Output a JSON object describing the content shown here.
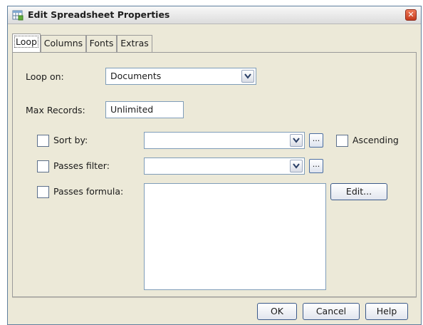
{
  "window": {
    "title": "Edit Spreadsheet Properties",
    "close_symbol": "✕"
  },
  "tabs": [
    {
      "label": "Loop",
      "active": true
    },
    {
      "label": "Columns",
      "active": false
    },
    {
      "label": "Fonts",
      "active": false
    },
    {
      "label": "Extras",
      "active": false
    }
  ],
  "loop": {
    "loop_on_label": "Loop on:",
    "loop_on_value": "Documents",
    "max_records_label": "Max Records:",
    "max_records_value": "Unlimited",
    "sort_by_label": "Sort by:",
    "sort_by_value": "",
    "sort_by_checked": false,
    "ascending_label": "Ascending",
    "ascending_checked": false,
    "passes_filter_label": "Passes filter:",
    "passes_filter_value": "",
    "passes_filter_checked": false,
    "passes_formula_label": "Passes formula:",
    "passes_formula_value": "",
    "passes_formula_checked": false,
    "browse_label": "...",
    "edit_label": "Edit..."
  },
  "footer": {
    "ok_label": "OK",
    "cancel_label": "Cancel",
    "help_label": "Help"
  },
  "icons": {
    "app": "spreadsheet-properties-icon",
    "close": "close-icon",
    "dropdown": "chevron-down-icon"
  },
  "colors": {
    "window_bg": "#ece9d8",
    "field_border": "#7f9db9",
    "close_red": "#c43a1c"
  }
}
